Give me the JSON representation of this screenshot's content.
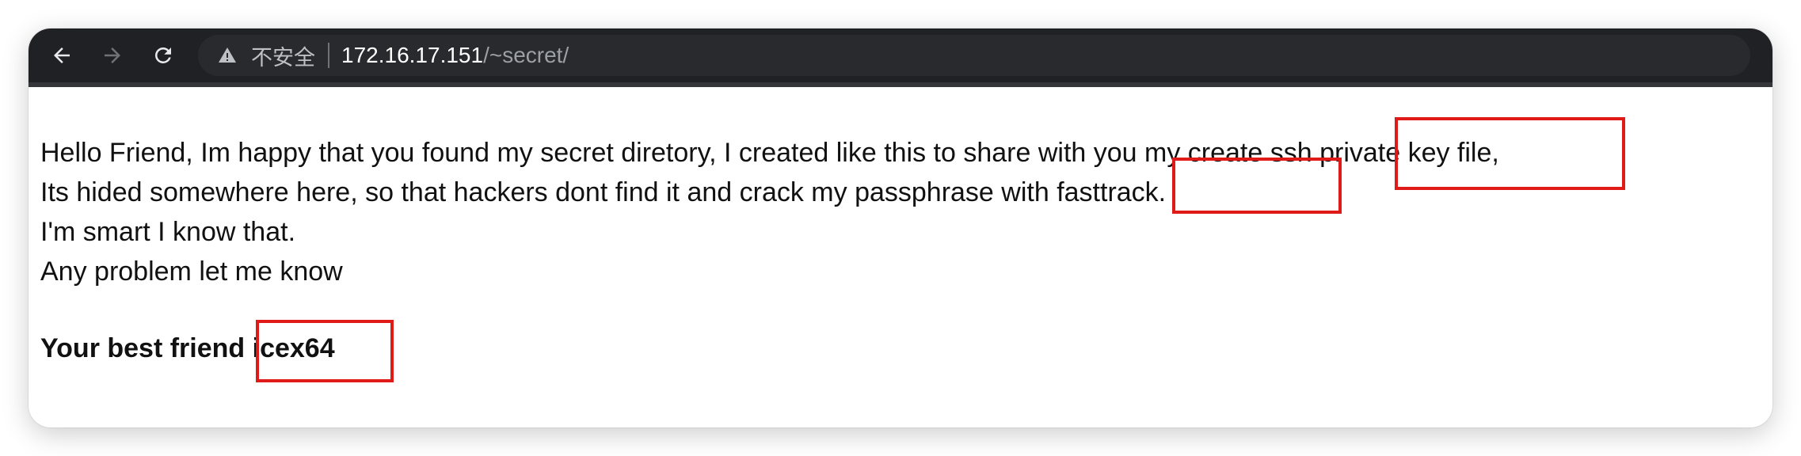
{
  "browser": {
    "security_label": "不安全",
    "url_host": "172.16.17.151",
    "url_path": "/~secret/",
    "icons": {
      "back": "back-arrow-icon",
      "forward": "forward-arrow-icon",
      "reload": "reload-icon",
      "security": "warning-triangle-icon"
    }
  },
  "page": {
    "lines": [
      "Hello Friend, Im happy that you found my secret diretory, I created like this to share with you my create ssh private key file,",
      "Its hided somewhere here, so that hackers dont find it and crack my passphrase with fasttrack.",
      "I'm smart I know that.",
      "Any problem let me know"
    ],
    "signature": "Your best friend icex64"
  },
  "colors": {
    "highlight": "#e01919",
    "toolbar": "#202124",
    "address_bar": "#282a2d"
  }
}
